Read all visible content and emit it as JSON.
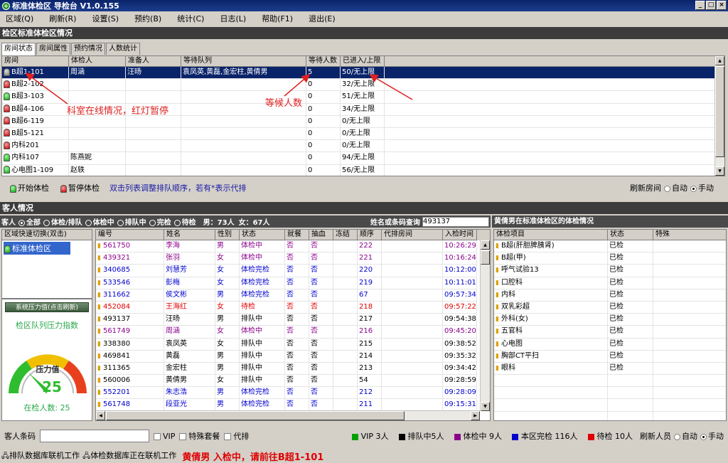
{
  "app": {
    "title": "标准体检区 导检台 V1.0.155"
  },
  "menu": [
    "区域(Q)",
    "刷新(R)",
    "设置(S)",
    "预约(B)",
    "统计(C)",
    "日志(L)",
    "帮助(F1)",
    "退出(E)"
  ],
  "room_section": {
    "title": "检区标准体检区情况",
    "tabs": [
      "房间状态",
      "房间属性",
      "预约情况",
      "人数统计"
    ]
  },
  "room_table": {
    "columns": [
      "房间",
      "体检人",
      "准备人",
      "等待队列",
      "等待人数",
      "已进入/上限"
    ],
    "rows": [
      {
        "status": "gray",
        "name": "B超1-101",
        "examinee": "周涵",
        "prepare": "汪旸",
        "queue": "袁凤英,黄磊,金宏柱,黄倩男",
        "waiting": "5",
        "entered": "50/无上限",
        "selected": true
      },
      {
        "status": "red",
        "name": "B超2-102",
        "examinee": "",
        "prepare": "",
        "queue": "",
        "waiting": "0",
        "entered": "32/无上限"
      },
      {
        "status": "green",
        "name": "B超3-103",
        "examinee": "",
        "prepare": "",
        "queue": "",
        "waiting": "0",
        "entered": "51/无上限"
      },
      {
        "status": "red",
        "name": "B超4-106",
        "examinee": "",
        "prepare": "",
        "queue": "",
        "waiting": "0",
        "entered": "34/无上限"
      },
      {
        "status": "red",
        "name": "B超6-119",
        "examinee": "",
        "prepare": "",
        "queue": "",
        "waiting": "0",
        "entered": "0/无上限"
      },
      {
        "status": "red",
        "name": "B超5-121",
        "examinee": "",
        "prepare": "",
        "queue": "",
        "waiting": "0",
        "entered": "0/无上限"
      },
      {
        "status": "red",
        "name": "内科201",
        "examinee": "",
        "prepare": "",
        "queue": "",
        "waiting": "0",
        "entered": "0/无上限"
      },
      {
        "status": "green",
        "name": "内科107",
        "examinee": "陈燕妮",
        "prepare": "",
        "queue": "",
        "waiting": "0",
        "entered": "94/无上限"
      },
      {
        "status": "green",
        "name": "心电图1-109",
        "examinee": "赵轶",
        "prepare": "",
        "queue": "",
        "waiting": "0",
        "entered": "56/无上限"
      }
    ]
  },
  "annotations": {
    "online": "科室在线情况，红灯暂停",
    "waiting": "等候人数"
  },
  "room_controls": {
    "start": "开始体检",
    "pause": "暂停体检",
    "hint": "双击列表调整排队顺序，若有*表示代排",
    "refresh_label": "刷新房间",
    "auto": "自动",
    "manual": "手动"
  },
  "customer_section": {
    "title": "客人情况"
  },
  "filters": {
    "label": "客人",
    "options": [
      "全部",
      "体检/排队",
      "体检中",
      "排队中",
      "完检",
      "待检"
    ],
    "male": "男：73人",
    "female": "女：67人",
    "search_label": "姓名或条码查询",
    "search_value": "493137"
  },
  "area_list": {
    "header": "区域快速切换(双击)",
    "items": [
      "标准体检区"
    ]
  },
  "pressure": {
    "button": "系统压力值(点击刷新)",
    "title": "检区队列压力指数",
    "gauge_label": "压力值",
    "value": "25",
    "fraction": 0.25,
    "in_exam": "在检人数: 25"
  },
  "customer_table": {
    "columns": [
      "编号",
      "姓名",
      "性别",
      "状态",
      "就餐",
      "抽血",
      "冻结",
      "顺序",
      "代排房间",
      "入检时间"
    ],
    "rows": [
      {
        "id": "561750",
        "name": "李海",
        "sex": "男",
        "status": "体检中",
        "meal": "否",
        "blood": "否",
        "frozen": "",
        "order": "222",
        "proxy": "",
        "time": "10:26:29",
        "color": "#8b008b"
      },
      {
        "id": "439321",
        "name": "张羽",
        "sex": "女",
        "status": "体检中",
        "meal": "否",
        "blood": "否",
        "frozen": "",
        "order": "221",
        "proxy": "",
        "time": "10:16:24",
        "color": "#8b008b"
      },
      {
        "id": "340685",
        "name": "刘慧芳",
        "sex": "女",
        "status": "体检完检",
        "meal": "否",
        "blood": "否",
        "frozen": "",
        "order": "220",
        "proxy": "",
        "time": "10:12:00",
        "color": "#0000cd"
      },
      {
        "id": "533546",
        "name": "彭梅",
        "sex": "女",
        "status": "体检完检",
        "meal": "否",
        "blood": "否",
        "frozen": "",
        "order": "219",
        "proxy": "",
        "time": "10:11:01",
        "color": "#0000cd"
      },
      {
        "id": "311662",
        "name": "侯文彬",
        "sex": "男",
        "status": "体检完检",
        "meal": "否",
        "blood": "否",
        "frozen": "",
        "order": "67",
        "proxy": "",
        "time": "09:57:34",
        "color": "#0000cd"
      },
      {
        "id": "452084",
        "name": "王海红",
        "sex": "女",
        "status": "待检",
        "meal": "否",
        "blood": "否",
        "frozen": "",
        "order": "218",
        "proxy": "",
        "time": "09:57:22",
        "color": "#e00000"
      },
      {
        "id": "493137",
        "name": "汪旸",
        "sex": "男",
        "status": "排队中",
        "meal": "否",
        "blood": "否",
        "frozen": "",
        "order": "217",
        "proxy": "",
        "time": "09:54:38",
        "color": "#000000"
      },
      {
        "id": "561749",
        "name": "周涵",
        "sex": "女",
        "status": "体检中",
        "meal": "否",
        "blood": "否",
        "frozen": "",
        "order": "216",
        "proxy": "",
        "time": "09:45:20",
        "color": "#8b008b"
      },
      {
        "id": "338380",
        "name": "袁凤英",
        "sex": "女",
        "status": "排队中",
        "meal": "否",
        "blood": "否",
        "frozen": "",
        "order": "215",
        "proxy": "",
        "time": "09:38:52",
        "color": "#000000"
      },
      {
        "id": "469841",
        "name": "黄磊",
        "sex": "男",
        "status": "排队中",
        "meal": "否",
        "blood": "否",
        "frozen": "",
        "order": "214",
        "proxy": "",
        "time": "09:35:32",
        "color": "#000000"
      },
      {
        "id": "311365",
        "name": "金宏柱",
        "sex": "男",
        "status": "排队中",
        "meal": "否",
        "blood": "否",
        "frozen": "",
        "order": "213",
        "proxy": "",
        "time": "09:34:42",
        "color": "#000000"
      },
      {
        "id": "560006",
        "name": "黄倩男",
        "sex": "女",
        "status": "排队中",
        "meal": "否",
        "blood": "否",
        "frozen": "",
        "order": "54",
        "proxy": "",
        "time": "09:28:59",
        "color": "#000000"
      },
      {
        "id": "552201",
        "name": "朱志浩",
        "sex": "男",
        "status": "体检完检",
        "meal": "否",
        "blood": "否",
        "frozen": "",
        "order": "212",
        "proxy": "",
        "time": "09:28:09",
        "color": "#0000cd"
      },
      {
        "id": "561748",
        "name": "段亚光",
        "sex": "男",
        "status": "体检完检",
        "meal": "否",
        "blood": "否",
        "frozen": "",
        "order": "211",
        "proxy": "",
        "time": "09:15:31",
        "color": "#0000cd"
      }
    ]
  },
  "detail": {
    "title": "黄倩男在标准体检区的体检情况",
    "columns": [
      "体检项目",
      "状态",
      "特殊"
    ],
    "rows": [
      {
        "item": "B超(肝胆脾胰肾)",
        "status": "已检"
      },
      {
        "item": "B超(甲)",
        "status": "已检"
      },
      {
        "item": "呼气试验13",
        "status": "已检"
      },
      {
        "item": "口腔科",
        "status": "已检"
      },
      {
        "item": "内科",
        "status": "已检"
      },
      {
        "item": "双乳彩超",
        "status": "已检"
      },
      {
        "item": "外科(女)",
        "status": "已检"
      },
      {
        "item": "五官科",
        "status": "已检"
      },
      {
        "item": "心电图",
        "status": "已检"
      },
      {
        "item": "胸部CT平扫",
        "status": "已检"
      },
      {
        "item": "眼科",
        "status": "已检"
      }
    ]
  },
  "bottom": {
    "barcode_label": "客人条码",
    "vip": "VIP",
    "special": "特殊套餐",
    "proxy": "代排",
    "legend": [
      {
        "label": "VIP 3人",
        "color": "#00a000"
      },
      {
        "label": "排队中5人",
        "color": "#000000"
      },
      {
        "label": "体检中 9人",
        "color": "#8b008b"
      },
      {
        "label": "本区完检 116人",
        "color": "#0000cd"
      },
      {
        "label": "待检 10人",
        "color": "#e00000"
      }
    ],
    "refresh_label": "刷新人员",
    "auto": "自动",
    "manual": "手动"
  },
  "statusbar": {
    "db1": "排队数据库联机工作",
    "db2": "体检数据库正在联机工作",
    "message": "黄倩男   入检中，请前往B超1-101"
  }
}
